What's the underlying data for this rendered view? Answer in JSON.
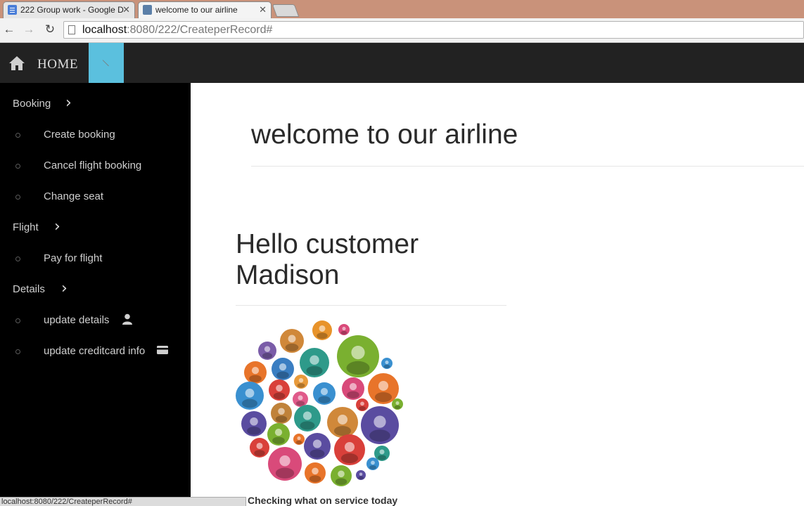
{
  "browser": {
    "tabs": [
      {
        "title": "222 Group work - Google D",
        "active": false
      },
      {
        "title": "welcome to our airline",
        "active": true
      }
    ],
    "url_host": "localhost",
    "url_rest": ":8080/222/CreateperRecord#"
  },
  "topnav": {
    "home_label": "HOME"
  },
  "sidebar": {
    "sections": [
      {
        "label": "Booking",
        "items": [
          "Create booking",
          "Cancel flight booking",
          "Change seat"
        ]
      },
      {
        "label": "Flight",
        "items": [
          "Pay for flight"
        ]
      },
      {
        "label": "Details",
        "items": [
          "update details",
          "update creditcard info"
        ]
      }
    ]
  },
  "main": {
    "title": "welcome to our airline",
    "greeting": "Hello customer Madison",
    "caption": "Checking what on service today"
  },
  "status_bar": "localhost:8080/222/CreateperRecord#",
  "colors": {
    "nav_bg": "#222222",
    "nav_accent": "#5bc0de",
    "sidebar_bg": "#000000"
  }
}
